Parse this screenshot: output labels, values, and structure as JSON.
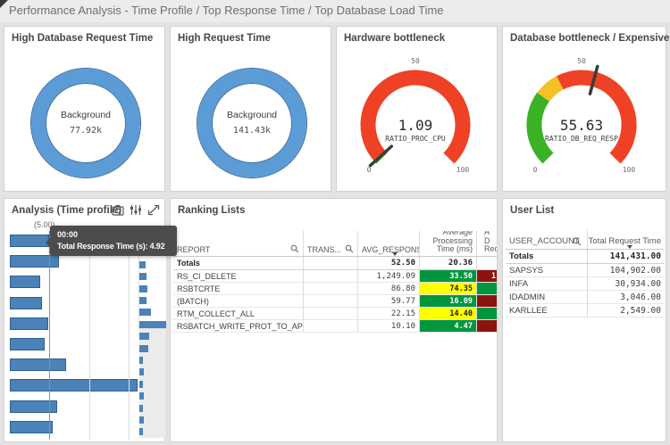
{
  "titlebar": {
    "title": "Performance Analysis - Time Profile / Top Response Time / Top Database Load Time"
  },
  "colors": {
    "accent_blue": "#5b9cd6",
    "blue_border": "#3a6ba3",
    "bar_blue": "#4b83b8",
    "bar_border": "#2e5f93",
    "gauge_red": "#ef4125",
    "gauge_green": "#3bb226",
    "gauge_yellow": "#f5c125",
    "cell_green": "#009640",
    "cell_yellow": "#ffff00",
    "cell_darkred": "#8b1410",
    "tooltip_bg": "#4c4c4c"
  },
  "donut1": {
    "title": "High Database Request Time"
  },
  "donut2": {
    "title": "High Request Time"
  },
  "gauge1": {
    "title": "Hardware bottleneck"
  },
  "gauge2": {
    "title": "Database bottleneck / Expensive SQL"
  },
  "analysis": {
    "title": "Analysis (Time profile)",
    "icons": [
      "camera-icon",
      "exploration-menu-icon",
      "fullscreen-icon"
    ],
    "axis_tick": "(5.00)",
    "tooltip": {
      "category": "00:00",
      "text": "Total Response Time (s): 4.92"
    },
    "minimap": [
      9,
      12,
      7,
      8,
      9,
      8,
      13,
      30,
      11,
      10,
      4,
      5,
      4,
      5,
      4,
      5,
      4
    ]
  },
  "ranking": {
    "title": "Ranking Lists",
    "columns": [
      "REPORT",
      "TRANS...",
      "AVG_RESPONS...",
      "Average\nProcessing\nTime (ms)",
      "A\nD\nRequ"
    ],
    "totals": {
      "report": "Totals",
      "avg_response": "52.50",
      "avg_processing": "20.36"
    },
    "rows": [
      {
        "report": "RS_CI_DELETE",
        "trans": "",
        "avg_response": "1,249.09",
        "avg_processing": "33.50",
        "avg_processing_color": "green",
        "db_request_visible": "1",
        "db_request_color": "darkred"
      },
      {
        "report": "RSBTCRTE",
        "trans": "",
        "avg_response": "86.80",
        "avg_processing": "74.35",
        "avg_processing_color": "yellow",
        "db_request_visible": "",
        "db_request_color": "green"
      },
      {
        "report": "(BATCH)",
        "trans": "",
        "avg_response": "59.77",
        "avg_processing": "16.09",
        "avg_processing_color": "green",
        "db_request_visible": "",
        "db_request_color": "darkred"
      },
      {
        "report": "RTM_COLLECT_ALL",
        "trans": "",
        "avg_response": "22.15",
        "avg_processing": "14.40",
        "avg_processing_color": "yellow",
        "db_request_visible": "",
        "db_request_color": "green"
      },
      {
        "report": "RSBATCH_WRITE_PROT_TO_APPLLOG",
        "trans": "",
        "avg_response": "10.10",
        "avg_processing": "4.47",
        "avg_processing_color": "green",
        "db_request_visible": "",
        "db_request_color": "darkred"
      }
    ]
  },
  "user_list": {
    "title": "User List",
    "columns": [
      "USER_ACCOUNT",
      "Total Request Time"
    ],
    "totals": {
      "account": "Totals",
      "value": "141,431.00"
    },
    "rows": [
      {
        "account": "SAPSYS",
        "value": "104,902.00"
      },
      {
        "account": "INFA",
        "value": "30,934.00"
      },
      {
        "account": "IDADMIN",
        "value": "3,046.00"
      },
      {
        "account": "KARLLEE",
        "value": "2,549.00"
      }
    ]
  },
  "chart_data": [
    {
      "type": "pie",
      "subtype": "donut",
      "title": "High Database Request Time",
      "labels": [
        "Background"
      ],
      "values": [
        77920
      ],
      "center_label": "Background",
      "center_value": "77.92k",
      "color": "#5b9cd6"
    },
    {
      "type": "pie",
      "subtype": "donut",
      "title": "High Request Time",
      "labels": [
        "Background"
      ],
      "values": [
        141430
      ],
      "center_label": "Background",
      "center_value": "141.43k",
      "color": "#5b9cd6"
    },
    {
      "type": "gauge",
      "title": "Hardware bottleneck",
      "value": 1.09,
      "value_text": "1.09",
      "measure": "RATIO_PROC_CPU",
      "range": [
        0,
        100
      ],
      "ticks": [
        "0",
        "50",
        "100"
      ],
      "segments": [
        {
          "from": 0,
          "to": 1.8,
          "color": "green"
        },
        {
          "from": 1.8,
          "to": 100,
          "color": "red"
        }
      ]
    },
    {
      "type": "gauge",
      "title": "Database bottleneck / Expensive SQL",
      "value": 55.63,
      "value_text": "55.63",
      "measure": "RATIO_DB_REQ_RESP",
      "range": [
        0,
        100
      ],
      "ticks": [
        "0",
        "50",
        "100"
      ],
      "segments": [
        {
          "from": 0,
          "to": 30,
          "color": "green"
        },
        {
          "from": 30,
          "to": 40,
          "color": "yellow"
        },
        {
          "from": 40,
          "to": 100,
          "color": "red"
        }
      ]
    },
    {
      "type": "bar",
      "orientation": "horizontal",
      "title": "Analysis (Time profile)",
      "categories": [
        "00:00",
        "",
        "",
        "",
        "",
        "",
        "",
        "",
        "",
        ""
      ],
      "values": [
        4.92,
        6.2,
        3.8,
        4.1,
        4.9,
        4.4,
        7.1,
        16.1,
        6.0,
        5.4
      ],
      "xlabel": "Total Response Time (s)",
      "xlim": [
        0,
        16.5
      ],
      "gridlines": [
        5,
        10,
        15
      ],
      "visible_tick_label": "(5.00)",
      "grid": true,
      "legend": false
    }
  ]
}
